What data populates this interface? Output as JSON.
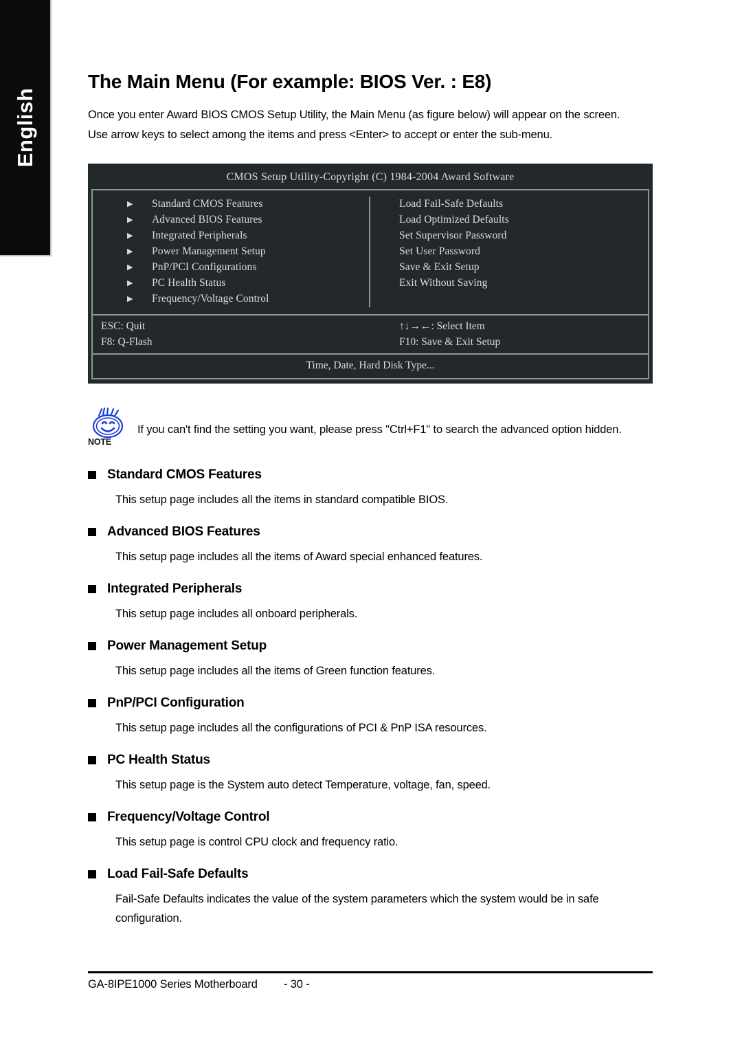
{
  "language_tab": {
    "label": "English"
  },
  "page": {
    "title": "The Main Menu (For example: BIOS Ver. : E8)",
    "intro_line_1": "Once you enter Award BIOS CMOS Setup Utility, the Main Menu (as figure below) will appear on the screen.",
    "intro_line_2": "Use arrow keys to select among the items and press <Enter> to accept or enter the sub-menu."
  },
  "bios_screen": {
    "title": "CMOS Setup Utility-Copyright (C) 1984-2004 Award Software",
    "arrow_glyph": "▶",
    "left_items": [
      "Standard CMOS Features",
      "Advanced BIOS Features",
      "Integrated Peripherals",
      "Power Management Setup",
      "PnP/PCI Configurations",
      "PC Health Status",
      "Frequency/Voltage Control"
    ],
    "right_items": [
      "Load Fail-Safe Defaults",
      "Load Optimized Defaults",
      "Set Supervisor Password",
      "Set User Password",
      "Save & Exit Setup",
      "Exit Without Saving"
    ],
    "keys": {
      "esc": "ESC: Quit",
      "f8": "F8: Q-Flash",
      "select": "↑↓→←: Select Item",
      "f10": "F10: Save & Exit Setup"
    },
    "status_line": "Time, Date, Hard Disk Type...",
    "colors": {
      "background": "#23292b",
      "border": "#8e9495",
      "text": "#dcdcd4"
    }
  },
  "note": {
    "icon_label": "NOTE",
    "text": "If you can't find the setting you want, please press \"Ctrl+F1\" to search the advanced option hidden.",
    "icon_color": "#1a3ed8"
  },
  "sections": [
    {
      "title": "Standard CMOS Features",
      "body": "This setup page includes all the items in standard compatible BIOS."
    },
    {
      "title": "Advanced BIOS Features",
      "body": "This setup page includes all the items of Award special enhanced features."
    },
    {
      "title": "Integrated Peripherals",
      "body": "This setup page includes all onboard peripherals."
    },
    {
      "title": "Power Management Setup",
      "body": "This setup page includes all the items of Green function features."
    },
    {
      "title": "PnP/PCI Configuration",
      "body": "This setup page includes all the configurations of PCI & PnP ISA resources."
    },
    {
      "title": "PC Health Status",
      "body": "This setup page is the System auto detect Temperature, voltage, fan, speed."
    },
    {
      "title": "Frequency/Voltage Control",
      "body": "This setup page is control CPU clock and frequency ratio."
    },
    {
      "title": "Load Fail-Safe Defaults",
      "body": "Fail-Safe Defaults indicates the value of the system parameters which the system would be in safe configuration."
    }
  ],
  "footer": {
    "product": "GA-8IPE1000 Series Motherboard",
    "page_number": "- 30 -"
  }
}
